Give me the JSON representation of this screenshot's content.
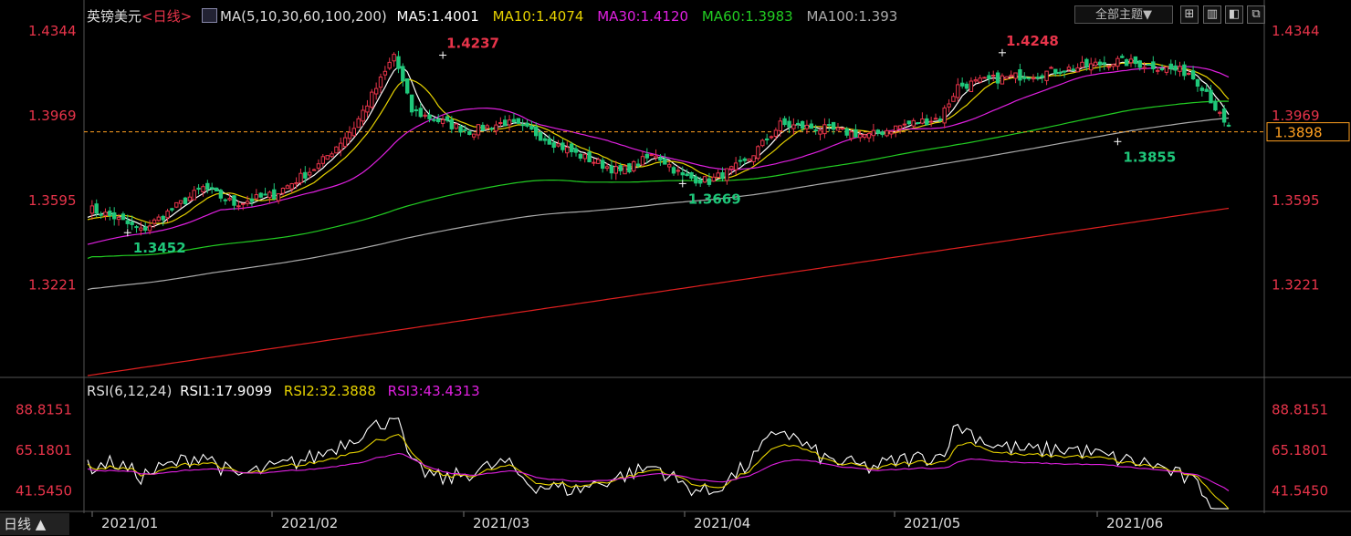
{
  "header": {
    "symbol": "英镑美元",
    "period": "<日线>",
    "ma_label": "MA(5,10,30,60,100,200)",
    "ma_values": [
      {
        "text": "MA5:1.4001",
        "color": "#ffffff"
      },
      {
        "text": "MA10:1.4074",
        "color": "#e6d200"
      },
      {
        "text": "MA30:1.4120",
        "color": "#e020e0"
      },
      {
        "text": "MA60:1.3983",
        "color": "#22cc22"
      },
      {
        "text": "MA100:1.393",
        "color": "#aaaaaa"
      }
    ],
    "theme_button": "全部主题▼",
    "toolbar_icons": [
      "grid-icon",
      "columns-icon",
      "expand-icon",
      "fullscreen-icon"
    ]
  },
  "rsi": {
    "label": "RSI(6,12,24)",
    "rsi1": "RSI1:17.9099",
    "rsi2": "RSI2:32.3888",
    "rsi3": "RSI3:43.4313",
    "colors": {
      "rsi1": "#ffffff",
      "rsi2": "#e6d200",
      "rsi3": "#e020e0"
    }
  },
  "footer": {
    "timeframe_label": "日线 ▲"
  },
  "colors": {
    "up": "#e8344a",
    "down": "#1fc77a",
    "price_axis": "#e8344a",
    "last_price_line": "#ffa020"
  },
  "chart_data": {
    "type": "candlestick",
    "title": "英镑美元 日线",
    "x_ticks": [
      "2021/01",
      "2021/02",
      "2021/03",
      "2021/04",
      "2021/05",
      "2021/06"
    ],
    "price_axis_ticks": [
      "1.4344",
      "1.3969",
      "1.3595",
      "1.3221"
    ],
    "rsi_axis_ticks": [
      "88.8151",
      "65.1801",
      "41.5450"
    ],
    "ylim": [
      1.282,
      1.4344
    ],
    "rsi_ylim": [
      30,
      95
    ],
    "last_price": "1.3898",
    "annotations": [
      {
        "text": "1.4237",
        "type": "high",
        "month_index": 1.85
      },
      {
        "text": "1.4248",
        "type": "high",
        "month_index": 4.78
      },
      {
        "text": "1.3452",
        "type": "low",
        "month_index": 0.22
      },
      {
        "text": "1.3669",
        "type": "low",
        "month_index": 3.12
      },
      {
        "text": "1.3855",
        "type": "low",
        "month_index": 5.4
      }
    ],
    "price_anchors": [
      [
        0,
        1.356
      ],
      [
        6,
        1.352
      ],
      [
        12,
        1.346
      ],
      [
        18,
        1.354
      ],
      [
        26,
        1.365
      ],
      [
        33,
        1.358
      ],
      [
        42,
        1.362
      ],
      [
        52,
        1.375
      ],
      [
        60,
        1.392
      ],
      [
        67,
        1.416
      ],
      [
        69,
        1.424
      ],
      [
        73,
        1.399
      ],
      [
        80,
        1.394
      ],
      [
        86,
        1.39
      ],
      [
        94,
        1.394
      ],
      [
        100,
        1.39
      ],
      [
        110,
        1.38
      ],
      [
        120,
        1.372
      ],
      [
        128,
        1.38
      ],
      [
        134,
        1.37
      ],
      [
        140,
        1.368
      ],
      [
        148,
        1.376
      ],
      [
        156,
        1.393
      ],
      [
        166,
        1.391
      ],
      [
        176,
        1.388
      ],
      [
        184,
        1.393
      ],
      [
        192,
        1.396
      ],
      [
        196,
        1.41
      ],
      [
        204,
        1.413
      ],
      [
        212,
        1.415
      ],
      [
        222,
        1.418
      ],
      [
        232,
        1.421
      ],
      [
        240,
        1.419
      ],
      [
        248,
        1.416
      ],
      [
        252,
        1.408
      ],
      [
        256,
        1.393
      ],
      [
        258,
        1.39
      ]
    ],
    "rsi_anchors": [
      [
        0,
        55
      ],
      [
        6,
        58
      ],
      [
        12,
        50
      ],
      [
        18,
        56
      ],
      [
        26,
        63
      ],
      [
        33,
        50
      ],
      [
        42,
        55
      ],
      [
        52,
        62
      ],
      [
        60,
        73
      ],
      [
        67,
        82
      ],
      [
        69,
        88
      ],
      [
        73,
        56
      ],
      [
        80,
        48
      ],
      [
        86,
        52
      ],
      [
        94,
        58
      ],
      [
        100,
        45
      ],
      [
        110,
        42
      ],
      [
        120,
        50
      ],
      [
        128,
        56
      ],
      [
        134,
        45
      ],
      [
        140,
        40
      ],
      [
        148,
        55
      ],
      [
        156,
        78
      ],
      [
        166,
        60
      ],
      [
        176,
        55
      ],
      [
        184,
        60
      ],
      [
        192,
        62
      ],
      [
        196,
        80
      ],
      [
        204,
        68
      ],
      [
        212,
        65
      ],
      [
        222,
        66
      ],
      [
        232,
        60
      ],
      [
        240,
        57
      ],
      [
        248,
        48
      ],
      [
        252,
        40
      ],
      [
        256,
        20
      ],
      [
        258,
        18
      ]
    ],
    "series": [
      {
        "name": "MA5",
        "period": 5,
        "color": "#ffffff"
      },
      {
        "name": "MA10",
        "period": 10,
        "color": "#e6d200"
      },
      {
        "name": "MA30",
        "period": 30,
        "color": "#e020e0"
      },
      {
        "name": "MA60",
        "period": 60,
        "color": "#22cc22"
      },
      {
        "name": "MA100",
        "period": 100,
        "color": "#aaaaaa"
      },
      {
        "name": "MA200",
        "period": 200,
        "color": "#e02020"
      }
    ],
    "ma_start": {
      "MA5": 1.352,
      "MA10": 1.351,
      "MA30": 1.34,
      "MA60": 1.323,
      "MA100": 1.314,
      "MA200": 1.282
    },
    "ma_end": {
      "MA5": 1.3999,
      "MA10": 1.4064,
      "MA30": 1.41,
      "MA60": 1.397,
      "MA100": 1.3925,
      "MA200": 1.356
    },
    "candle_count": 258
  }
}
